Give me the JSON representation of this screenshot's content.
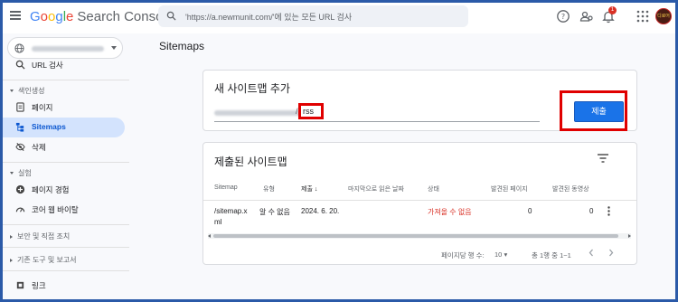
{
  "header": {
    "logo_google": "Google",
    "logo_product": "Search Console",
    "search_placeholder": "'https://a.newmunit.com/'에 있는 모든 URL 검사",
    "notification_count": "1",
    "avatar_text": "디로어"
  },
  "sidebar": {
    "url_inspection": "URL 검사",
    "sections": [
      {
        "label": "색인생성"
      },
      {
        "label": "실험"
      },
      {
        "label": "보안 및 직접 조치"
      },
      {
        "label": "기존 도구 및 보고서"
      }
    ],
    "items": [
      {
        "label": "페이지"
      },
      {
        "label": "Sitemaps"
      },
      {
        "label": "삭제"
      },
      {
        "label": "페이지 경험"
      },
      {
        "label": "코어 웹 바이탈"
      },
      {
        "label": "링크"
      }
    ]
  },
  "main": {
    "page_title": "Sitemaps",
    "add_card": {
      "title": "새 사이트맵 추가",
      "input_value": "rss",
      "submit_label": "제출"
    },
    "submitted_card": {
      "title": "제출된 사이트맵",
      "columns": [
        "Sitemap",
        "유형",
        "제출",
        "마지막으로 읽은 날짜",
        "상태",
        "발견된 페이지",
        "발견된 동영상"
      ],
      "rows": [
        {
          "sitemap_line1": "/sitemap.x",
          "sitemap_line2": "ml",
          "type": "알 수 없음",
          "submitted": "2024. 6. 20.",
          "last_read": "",
          "status": "가져올 수 없음",
          "pages": "0",
          "videos": "0"
        }
      ],
      "pager": {
        "rows_per_page_label": "페이지당 행 수:",
        "rows_per_page": "10",
        "range": "총 1행 중 1~1"
      }
    }
  },
  "colors": {
    "accent": "#1a73e8",
    "active_nav_bg": "#d3e3fd",
    "highlight_red": "#e00000",
    "error_text": "#d93025"
  }
}
